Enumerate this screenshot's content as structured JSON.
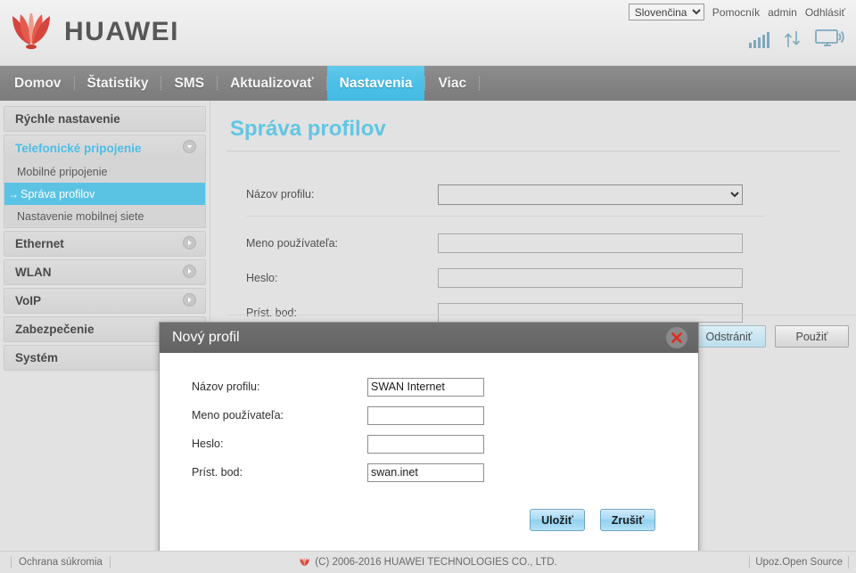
{
  "header": {
    "brand": "HUAWEI",
    "logo_icon": "huawei-flower-logo",
    "language": {
      "selected": "Slovenčina",
      "options": [
        "Slovenčina"
      ]
    },
    "links": {
      "help": "Pomocník",
      "user": "admin",
      "logout": "Odhlásiť"
    },
    "status_icons": [
      {
        "name": "signal-bars-icon",
        "bars": 5
      },
      {
        "name": "data-transfer-arrows-icon"
      },
      {
        "name": "connected-device-icon"
      }
    ]
  },
  "nav": {
    "items": [
      {
        "label": "Domov",
        "active": false
      },
      {
        "label": "Štatistiky",
        "active": false
      },
      {
        "label": "SMS",
        "active": false
      },
      {
        "label": "Aktualizovať",
        "active": false
      },
      {
        "label": "Nastavenia",
        "active": true
      },
      {
        "label": "Viac",
        "active": false
      }
    ]
  },
  "sidebar": {
    "groups": [
      {
        "label": "Rýchle nastavenie",
        "expanded": false,
        "icon": "none",
        "children": []
      },
      {
        "label": "Telefonické pripojenie",
        "expanded": true,
        "icon": "chevron-down-icon",
        "children": [
          {
            "label": "Mobilné pripojenie",
            "active": false
          },
          {
            "label": "Správa profilov",
            "active": true,
            "prefix": "→"
          },
          {
            "label": "Nastavenie mobilnej siete",
            "active": false
          }
        ]
      },
      {
        "label": "Ethernet",
        "expanded": false,
        "icon": "chevron-right-icon",
        "children": []
      },
      {
        "label": "WLAN",
        "expanded": false,
        "icon": "chevron-right-icon",
        "children": []
      },
      {
        "label": "VoIP",
        "expanded": false,
        "icon": "chevron-right-icon",
        "children": []
      },
      {
        "label": "Zabezpečenie",
        "expanded": false,
        "icon": "chevron-right-icon",
        "children": []
      },
      {
        "label": "Systém",
        "expanded": false,
        "icon": "chevron-right-icon",
        "children": []
      }
    ]
  },
  "main": {
    "title": "Správa profilov",
    "fields": {
      "profile_name_label": "Názov profilu:",
      "profile_name_value": "",
      "username_label": "Meno používateľa:",
      "username_value": "",
      "password_label": "Heslo:",
      "password_value": "",
      "apn_label": "Príst. bod:",
      "apn_value": ""
    },
    "buttons": {
      "delete": "Odstrániť",
      "apply": "Použiť"
    }
  },
  "modal": {
    "title": "Nový profil",
    "close_icon": "close-x-icon",
    "fields": {
      "profile_name_label": "Názov profilu:",
      "profile_name_value": "SWAN Internet",
      "username_label": "Meno používateľa:",
      "username_value": "",
      "password_label": "Heslo:",
      "password_value": "",
      "apn_label": "Príst. bod:",
      "apn_value": "swan.inet"
    },
    "buttons": {
      "save": "Uložiť",
      "cancel": "Zrušiť"
    }
  },
  "footer": {
    "privacy": "Ochrana súkromia",
    "copyright": "(C) 2006-2016 HUAWEI TECHNOLOGIES CO., LTD.",
    "open_source": "Upoz.Open Source",
    "logo_icon": "huawei-flower-logo-small"
  },
  "colors": {
    "accent_blue": "#4cbfe6",
    "title_blue": "#62c6e3",
    "nav_gray": "#838383",
    "page_bg": "#e2e2e2",
    "brand_red": "#cf3b32"
  }
}
